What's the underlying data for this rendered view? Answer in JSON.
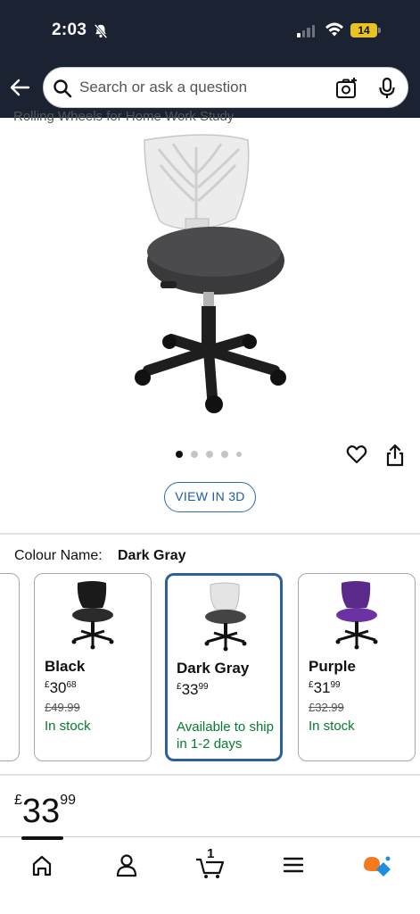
{
  "status_bar": {
    "time": "2:03",
    "battery": "14"
  },
  "header": {
    "search_placeholder": "Search or ask a question"
  },
  "product": {
    "clipped_title": "Rolling Wheels for Home Work Study",
    "image_count": 5,
    "active_image": 1,
    "view_3d_label": "VIEW IN 3D"
  },
  "colour": {
    "label": "Colour Name:",
    "selected": "Dark Gray",
    "options": [
      {
        "name": "Black",
        "price_currency": "£",
        "price_whole": "30",
        "price_fraction": "68",
        "was_price": "£49.99",
        "stock": "In stock",
        "chair_color": "#1a1a1a"
      },
      {
        "name": "Dark Gray",
        "price_currency": "£",
        "price_whole": "33",
        "price_fraction": "99",
        "was_price": "",
        "stock": "Available to ship in 1-2 days",
        "chair_color": "#e6e6e6"
      },
      {
        "name": "Purple",
        "price_currency": "£",
        "price_whole": "31",
        "price_fraction": "99",
        "was_price": "£32.99",
        "stock": "In stock",
        "chair_color": "#5a2a8a"
      }
    ]
  },
  "main_price": {
    "currency": "£",
    "whole": "33",
    "fraction": "99"
  },
  "bottom_nav": {
    "cart_count": "1",
    "items": [
      "home-icon",
      "account-icon",
      "cart-icon",
      "menu-icon",
      "rufus-icon"
    ]
  },
  "colors": {
    "header_bg": "#1b2332",
    "selected_border": "#2b5f9e",
    "in_stock_green": "#077a2e",
    "link_blue": "#1e5aa8"
  }
}
